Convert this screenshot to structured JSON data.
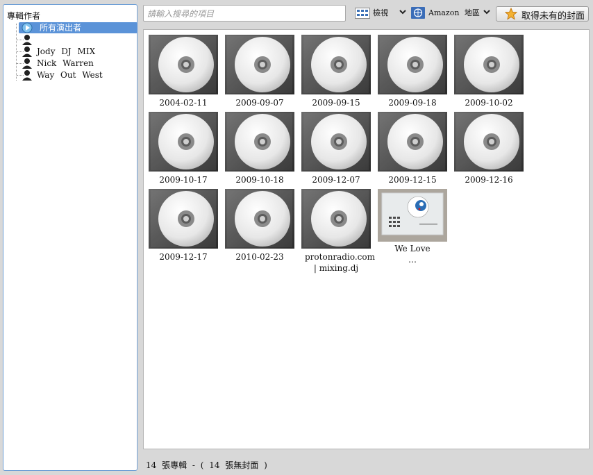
{
  "left_pane": {
    "title": "專輯作者",
    "artists": [
      {
        "label": "所有演出者",
        "selected": true
      },
      {
        "label": "",
        "selected": false
      },
      {
        "label": "Jody DJ MIX",
        "selected": false
      },
      {
        "label": "Nick Warren",
        "selected": false
      },
      {
        "label": "Way Out West",
        "selected": false
      }
    ]
  },
  "toolbar": {
    "search_placeholder": "請輸入搜尋的項目",
    "view_label": "檢視",
    "amazon_label": "Amazon 地區",
    "fetch_covers_label": "取得未有的封面"
  },
  "albums": [
    {
      "title": "2004-02-11",
      "cover": "default-cd"
    },
    {
      "title": "2009-09-07",
      "cover": "default-cd"
    },
    {
      "title": "2009-09-15",
      "cover": "default-cd"
    },
    {
      "title": "2009-09-18",
      "cover": "default-cd"
    },
    {
      "title": "2009-10-02",
      "cover": "default-cd"
    },
    {
      "title": "2009-10-17",
      "cover": "default-cd"
    },
    {
      "title": "2009-10-18",
      "cover": "default-cd"
    },
    {
      "title": "2009-12-07",
      "cover": "default-cd"
    },
    {
      "title": "2009-12-15",
      "cover": "default-cd"
    },
    {
      "title": "2009-12-16",
      "cover": "default-cd"
    },
    {
      "title": "2009-12-17",
      "cover": "default-cd"
    },
    {
      "title": "2010-02-23",
      "cover": "default-cd"
    },
    {
      "title": "protonradio.com | mixing.dj",
      "cover": "default-cd"
    },
    {
      "title": "We Love …",
      "cover": "photo"
    }
  ],
  "status": {
    "text": "14 張專輯 - ( 14 張無封面 )"
  },
  "colors": {
    "selection": "#5b93d8",
    "pane_border": "#6e9fd6",
    "background": "#d8d8d8"
  }
}
